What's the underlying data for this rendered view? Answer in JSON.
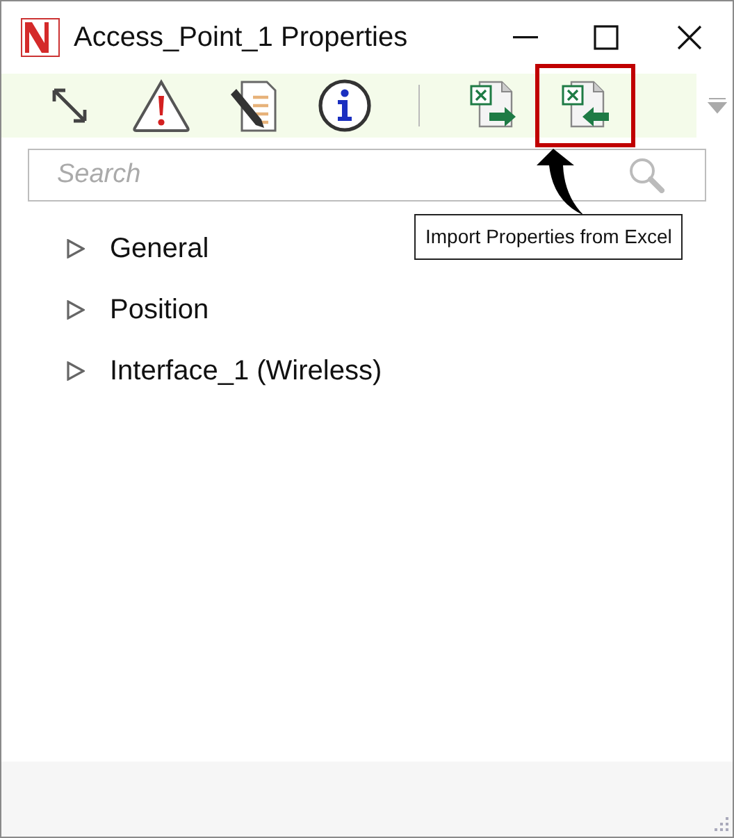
{
  "window": {
    "title": "Access_Point_1 Properties"
  },
  "toolbar": [
    {
      "kind": "resize",
      "highlighted": false
    },
    {
      "kind": "warning",
      "highlighted": false
    },
    {
      "kind": "edit",
      "highlighted": false
    },
    {
      "kind": "info",
      "highlighted": false
    },
    {
      "kind": "separator",
      "highlighted": false
    },
    {
      "kind": "export",
      "highlighted": false
    },
    {
      "kind": "import",
      "highlighted": true
    }
  ],
  "search": {
    "placeholder": "Search"
  },
  "tree": [
    {
      "label": "General",
      "expanded": false
    },
    {
      "label": "Position",
      "expanded": false
    },
    {
      "label": "Interface_1 (Wireless)",
      "expanded": false
    }
  ],
  "tooltip": {
    "text": "Import Properties from Excel"
  }
}
